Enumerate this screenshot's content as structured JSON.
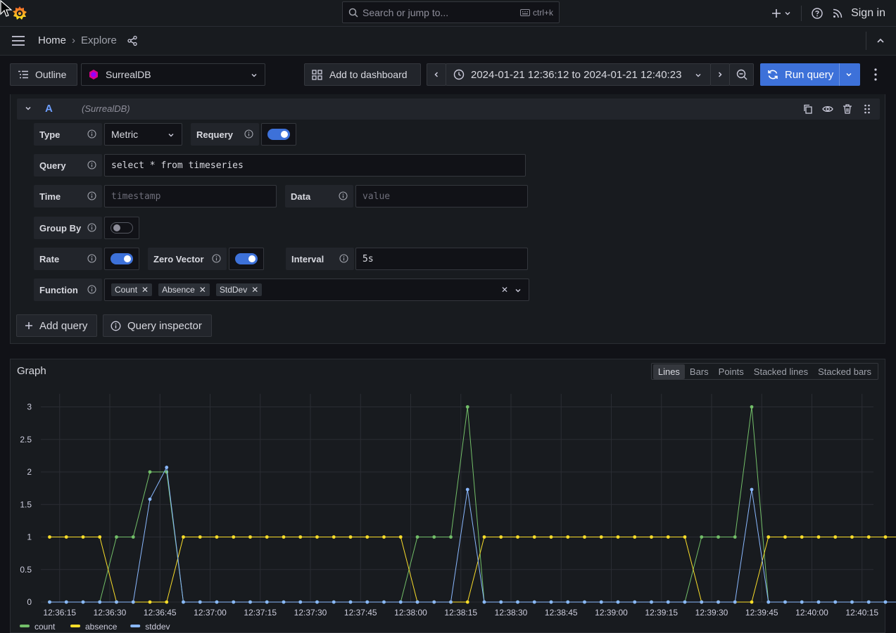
{
  "topbar": {
    "search_placeholder": "Search or jump to...",
    "search_shortcut": "ctrl+k",
    "sign_in": "Sign in"
  },
  "breadcrumb": {
    "home": "Home",
    "separator": "›",
    "current": "Explore"
  },
  "toolbar": {
    "outline": "Outline",
    "datasource": "SurrealDB",
    "add_to_dashboard": "Add to dashboard",
    "time_range": "2024-01-21 12:36:12 to 2024-01-21 12:40:23",
    "run_query": "Run query"
  },
  "query": {
    "ref_id": "A",
    "datasource_label": "(SurrealDB)",
    "type_label": "Type",
    "type_value": "Metric",
    "requery_label": "Requery",
    "requery_on": true,
    "query_label": "Query",
    "query_value": "select * from timeseries",
    "time_label": "Time",
    "time_placeholder": "timestamp",
    "data_label": "Data",
    "data_placeholder": "value",
    "groupby_label": "Group By",
    "groupby_on": false,
    "rate_label": "Rate",
    "rate_on": true,
    "zerovector_label": "Zero Vector",
    "zerovector_on": true,
    "interval_label": "Interval",
    "interval_value": "5s",
    "function_label": "Function",
    "functions": [
      "Count",
      "Absence",
      "StdDev"
    ]
  },
  "actions": {
    "add_query": "Add query",
    "query_inspector": "Query inspector"
  },
  "graph": {
    "title": "Graph",
    "view_options": [
      "Lines",
      "Bars",
      "Points",
      "Stacked lines",
      "Stacked bars"
    ],
    "active_view": "Lines"
  },
  "colors": {
    "count": "#73bf69",
    "absence": "#fade2a",
    "stddev": "#8ab8ff",
    "accent": "#3d71d9"
  },
  "chart_data": {
    "type": "line",
    "ylim": [
      0,
      3.2
    ],
    "yticks": [
      0,
      0.5,
      1,
      1.5,
      2,
      2.5,
      3
    ],
    "ytick_labels": [
      "0",
      "0.5",
      "1",
      "1.5",
      "2",
      "2.5",
      "3"
    ],
    "xtick_labels": [
      "12:36:15",
      "12:36:30",
      "12:36:45",
      "12:37:00",
      "12:37:15",
      "12:37:30",
      "12:37:45",
      "12:38:00",
      "12:38:15",
      "12:38:30",
      "12:38:45",
      "12:39:00",
      "12:39:15",
      "12:39:30",
      "12:39:45",
      "12:40:00",
      "12:40:15"
    ],
    "x_start": "12:36:12",
    "x_step_seconds": 5,
    "series": [
      {
        "name": "count",
        "color": "#73bf69",
        "values": [
          0,
          0,
          0,
          0,
          1,
          1,
          2,
          2,
          0,
          0,
          0,
          0,
          0,
          0,
          0,
          0,
          0,
          0,
          0,
          0,
          0,
          0,
          1,
          1,
          1,
          3,
          0,
          0,
          0,
          0,
          0,
          0,
          0,
          0,
          0,
          0,
          0,
          0,
          0,
          1,
          1,
          1,
          3,
          0,
          0,
          0,
          0,
          0,
          0,
          0,
          0,
          0
        ]
      },
      {
        "name": "absence",
        "color": "#fade2a",
        "values": [
          1,
          1,
          1,
          1,
          0,
          0,
          0,
          0,
          1,
          1,
          1,
          1,
          1,
          1,
          1,
          1,
          1,
          1,
          1,
          1,
          1,
          1,
          0,
          0,
          0,
          0,
          1,
          1,
          1,
          1,
          1,
          1,
          1,
          1,
          1,
          1,
          1,
          1,
          1,
          0,
          0,
          0,
          0,
          1,
          1,
          1,
          1,
          1,
          1,
          1,
          1,
          1
        ]
      },
      {
        "name": "stddev",
        "color": "#8ab8ff",
        "values": [
          0,
          0,
          0,
          0,
          0,
          0,
          1.58,
          2.07,
          0,
          0,
          0,
          0,
          0,
          0,
          0,
          0,
          0,
          0,
          0,
          0,
          0,
          0,
          0,
          0,
          0,
          1.73,
          0,
          0,
          0,
          0,
          0,
          0,
          0,
          0,
          0,
          0,
          0,
          0,
          0,
          0,
          0,
          0,
          1.73,
          0,
          0,
          0,
          0,
          0,
          0,
          0,
          0,
          0
        ]
      }
    ]
  }
}
